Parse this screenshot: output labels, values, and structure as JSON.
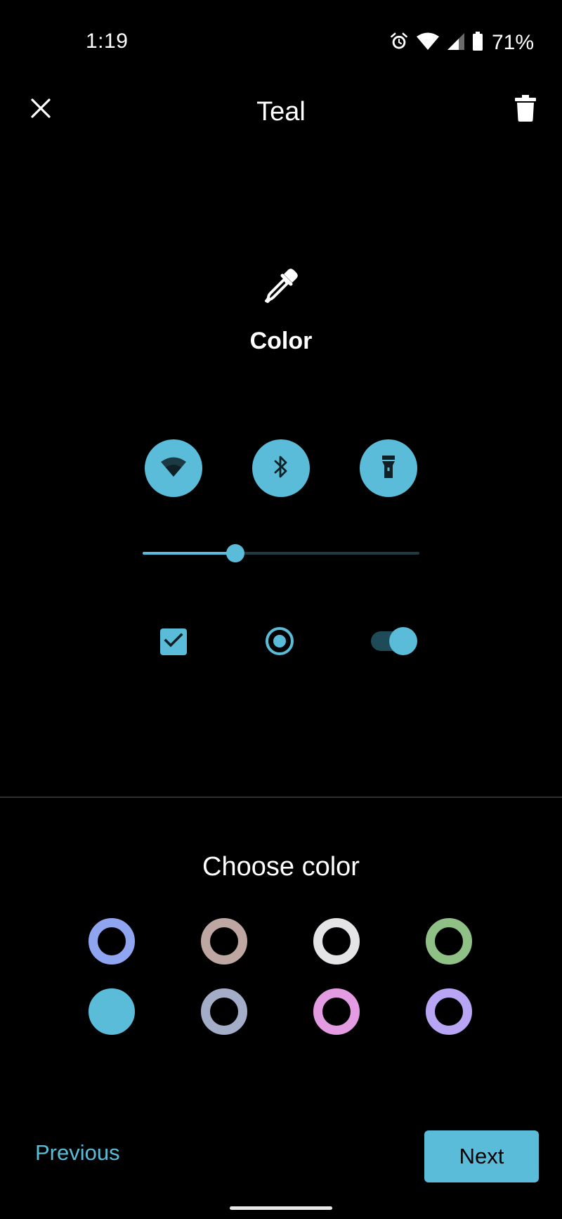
{
  "status_bar": {
    "time": "1:19",
    "battery": "71%",
    "icons": [
      "alarm-icon",
      "wifi-icon",
      "cell-signal-icon",
      "battery-icon"
    ]
  },
  "app_bar": {
    "title": "Teal",
    "close_icon": "close-icon",
    "delete_icon": "delete-icon"
  },
  "preview": {
    "label": "Color",
    "icon": "eyedropper-icon",
    "tiles": [
      "wifi-icon",
      "bluetooth-icon",
      "flashlight-icon"
    ],
    "slider_value": 0.33,
    "checkbox_checked": true,
    "radio_selected": true,
    "switch_on": true
  },
  "chooser": {
    "title": "Choose color",
    "swatches": [
      {
        "color": "#8fa5f0",
        "selected": false
      },
      {
        "color": "#bea7a3",
        "selected": false
      },
      {
        "color": "#e4e4e6",
        "selected": false
      },
      {
        "color": "#8fc187",
        "selected": false
      },
      {
        "color": "#5abcd8",
        "selected": true
      },
      {
        "color": "#a4adc8",
        "selected": false
      },
      {
        "color": "#e39be2",
        "selected": false
      },
      {
        "color": "#b8a6f4",
        "selected": false
      }
    ]
  },
  "nav": {
    "previous": "Previous",
    "next": "Next"
  },
  "colors": {
    "accent": "#5abcd8",
    "background": "#000000",
    "text": "#ffffff"
  }
}
